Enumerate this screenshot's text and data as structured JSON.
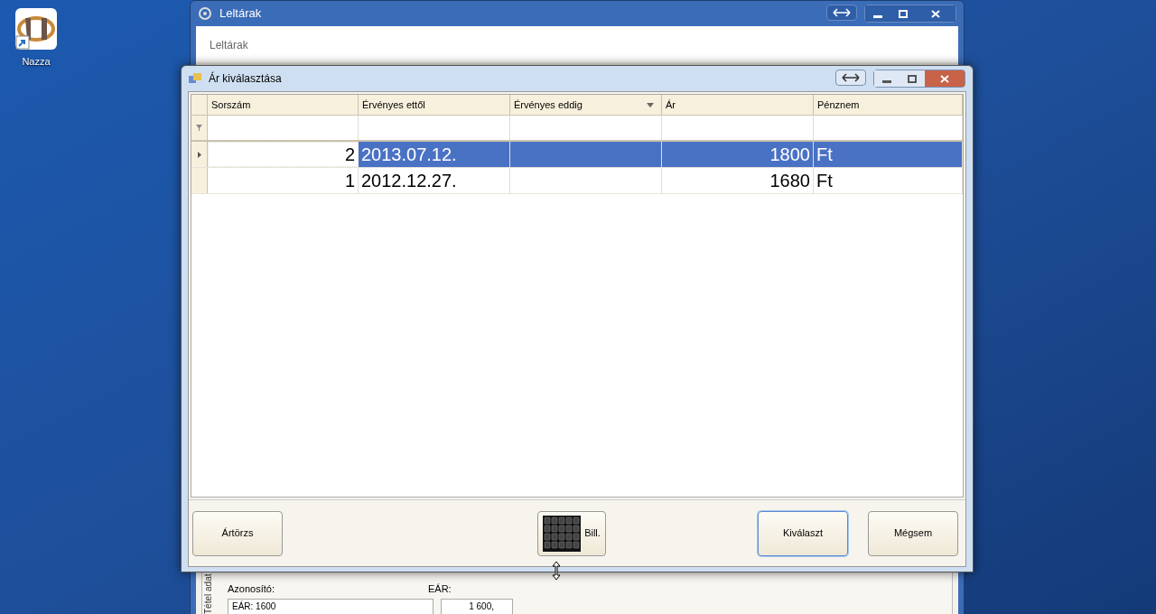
{
  "desktop_icons": [
    {
      "label": "Nazza"
    }
  ],
  "background_window": {
    "title": "Leltárak",
    "panel_title": "Leltárak",
    "group_label": "Tétel adat",
    "id_label": "Azonosító:",
    "id_value": "EÁR: 1600",
    "price_label": "EÁR:",
    "price_value": "1 600,"
  },
  "dialog": {
    "title": "Ár kiválasztása",
    "columns": [
      {
        "label": "Sorszám",
        "filter_menu": false,
        "kind": "number"
      },
      {
        "label": "Érvényes ettől",
        "filter_menu": false,
        "kind": "text"
      },
      {
        "label": "Érvényes eddig",
        "filter_menu": true,
        "kind": "text"
      },
      {
        "label": "Ár",
        "filter_menu": false,
        "kind": "number"
      },
      {
        "label": "Pénznem",
        "filter_menu": false,
        "kind": "text"
      }
    ],
    "rows": [
      {
        "selected": true,
        "cells": [
          "2",
          "2013.07.12.",
          null,
          "1800",
          "Ft"
        ]
      },
      {
        "selected": false,
        "cells": [
          "1",
          "2012.12.27.",
          null,
          "1680",
          "Ft"
        ]
      }
    ],
    "buttons": [
      {
        "label": "Ártörzs",
        "kind": "plain",
        "default": false
      },
      {
        "label": "Bill.",
        "kind": "keyboard",
        "default": false
      },
      {
        "label": "Kiválaszt",
        "kind": "plain",
        "default": true
      },
      {
        "label": "Mégsem",
        "kind": "plain",
        "default": false
      }
    ]
  }
}
